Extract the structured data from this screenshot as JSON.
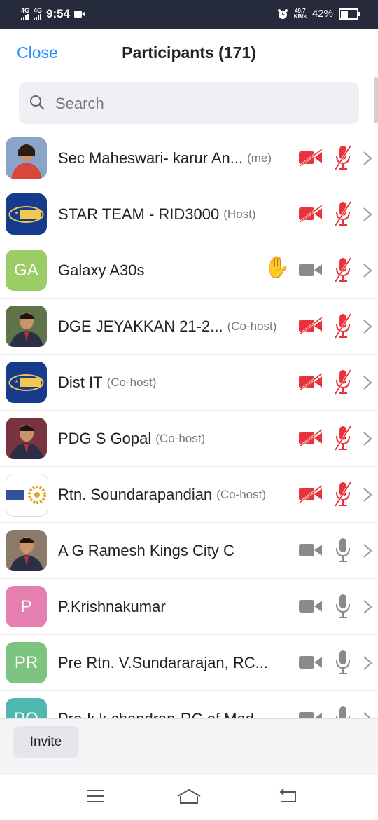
{
  "status_bar": {
    "sim1": "4G",
    "sim2": "4G",
    "time": "9:54",
    "net_speed": "49.7",
    "net_unit": "KB/s",
    "battery": "42%",
    "battery_level": 0.42
  },
  "header": {
    "close_label": "Close",
    "title": "Participants (171)"
  },
  "search": {
    "placeholder": "Search"
  },
  "participants": [
    {
      "name": "Sec Maheswari- karur An...",
      "role": "(me)",
      "initials": "",
      "avatar_icon": "photo-woman-icon",
      "avatar_color": "#8aa3c8",
      "video": "off",
      "audio": "muted",
      "hand": false
    },
    {
      "name": "STAR TEAM - RID3000",
      "role": "(Host)",
      "initials": "",
      "avatar_icon": "star-logo-icon",
      "avatar_color": "#173b8c",
      "video": "off",
      "audio": "muted",
      "hand": false
    },
    {
      "name": "Galaxy A30s",
      "role": "",
      "initials": "GA",
      "avatar_icon": "",
      "avatar_color": "#9ccc65",
      "video": "available",
      "audio": "muted",
      "hand": true
    },
    {
      "name": "DGE JEYAKKAN 21-2...",
      "role": "(Co-host)",
      "initials": "",
      "avatar_icon": "photo-man-icon",
      "avatar_color": "#5f7248",
      "video": "off",
      "audio": "muted",
      "hand": false
    },
    {
      "name": "Dist IT",
      "role": "(Co-host)",
      "initials": "",
      "avatar_icon": "star-logo-icon",
      "avatar_color": "#173b8c",
      "video": "off",
      "audio": "muted",
      "hand": false
    },
    {
      "name": "PDG S Gopal",
      "role": "(Co-host)",
      "initials": "",
      "avatar_icon": "photo-man-icon",
      "avatar_color": "#7a3340",
      "video": "off",
      "audio": "muted",
      "hand": false
    },
    {
      "name": "Rtn. Soundarapandian",
      "role": "(Co-host)",
      "initials": "",
      "avatar_icon": "rotary-logo-icon",
      "avatar_color": "#ffffff",
      "video": "off",
      "audio": "muted",
      "hand": false
    },
    {
      "name": "A G Ramesh Kings City C",
      "role": "",
      "initials": "",
      "avatar_icon": "photo-man-icon",
      "avatar_color": "#8c7a6a",
      "video": "available",
      "audio": "available",
      "hand": false
    },
    {
      "name": "P.Krishnakumar",
      "role": "",
      "initials": "P",
      "avatar_icon": "",
      "avatar_color": "#e57fb0",
      "video": "available",
      "audio": "available",
      "hand": false
    },
    {
      "name": "Pre Rtn. V.Sundararajan, RC...",
      "role": "",
      "initials": "PR",
      "avatar_icon": "",
      "avatar_color": "#7cc47f",
      "video": "available",
      "audio": "available",
      "hand": false
    },
    {
      "name": "Pre-k.k.chandran-RC of Mad...",
      "role": "",
      "initials": "PO",
      "avatar_icon": "",
      "avatar_color": "#4fb7b0",
      "video": "available",
      "audio": "available",
      "hand": false
    }
  ],
  "footer": {
    "invite_label": "Invite"
  },
  "colors": {
    "accent": "#2d8cff",
    "muted_red": "#e8323c",
    "icon_gray": "#8a8a8a",
    "status_bar": "#252b3a",
    "hand": "#f2b82b"
  }
}
